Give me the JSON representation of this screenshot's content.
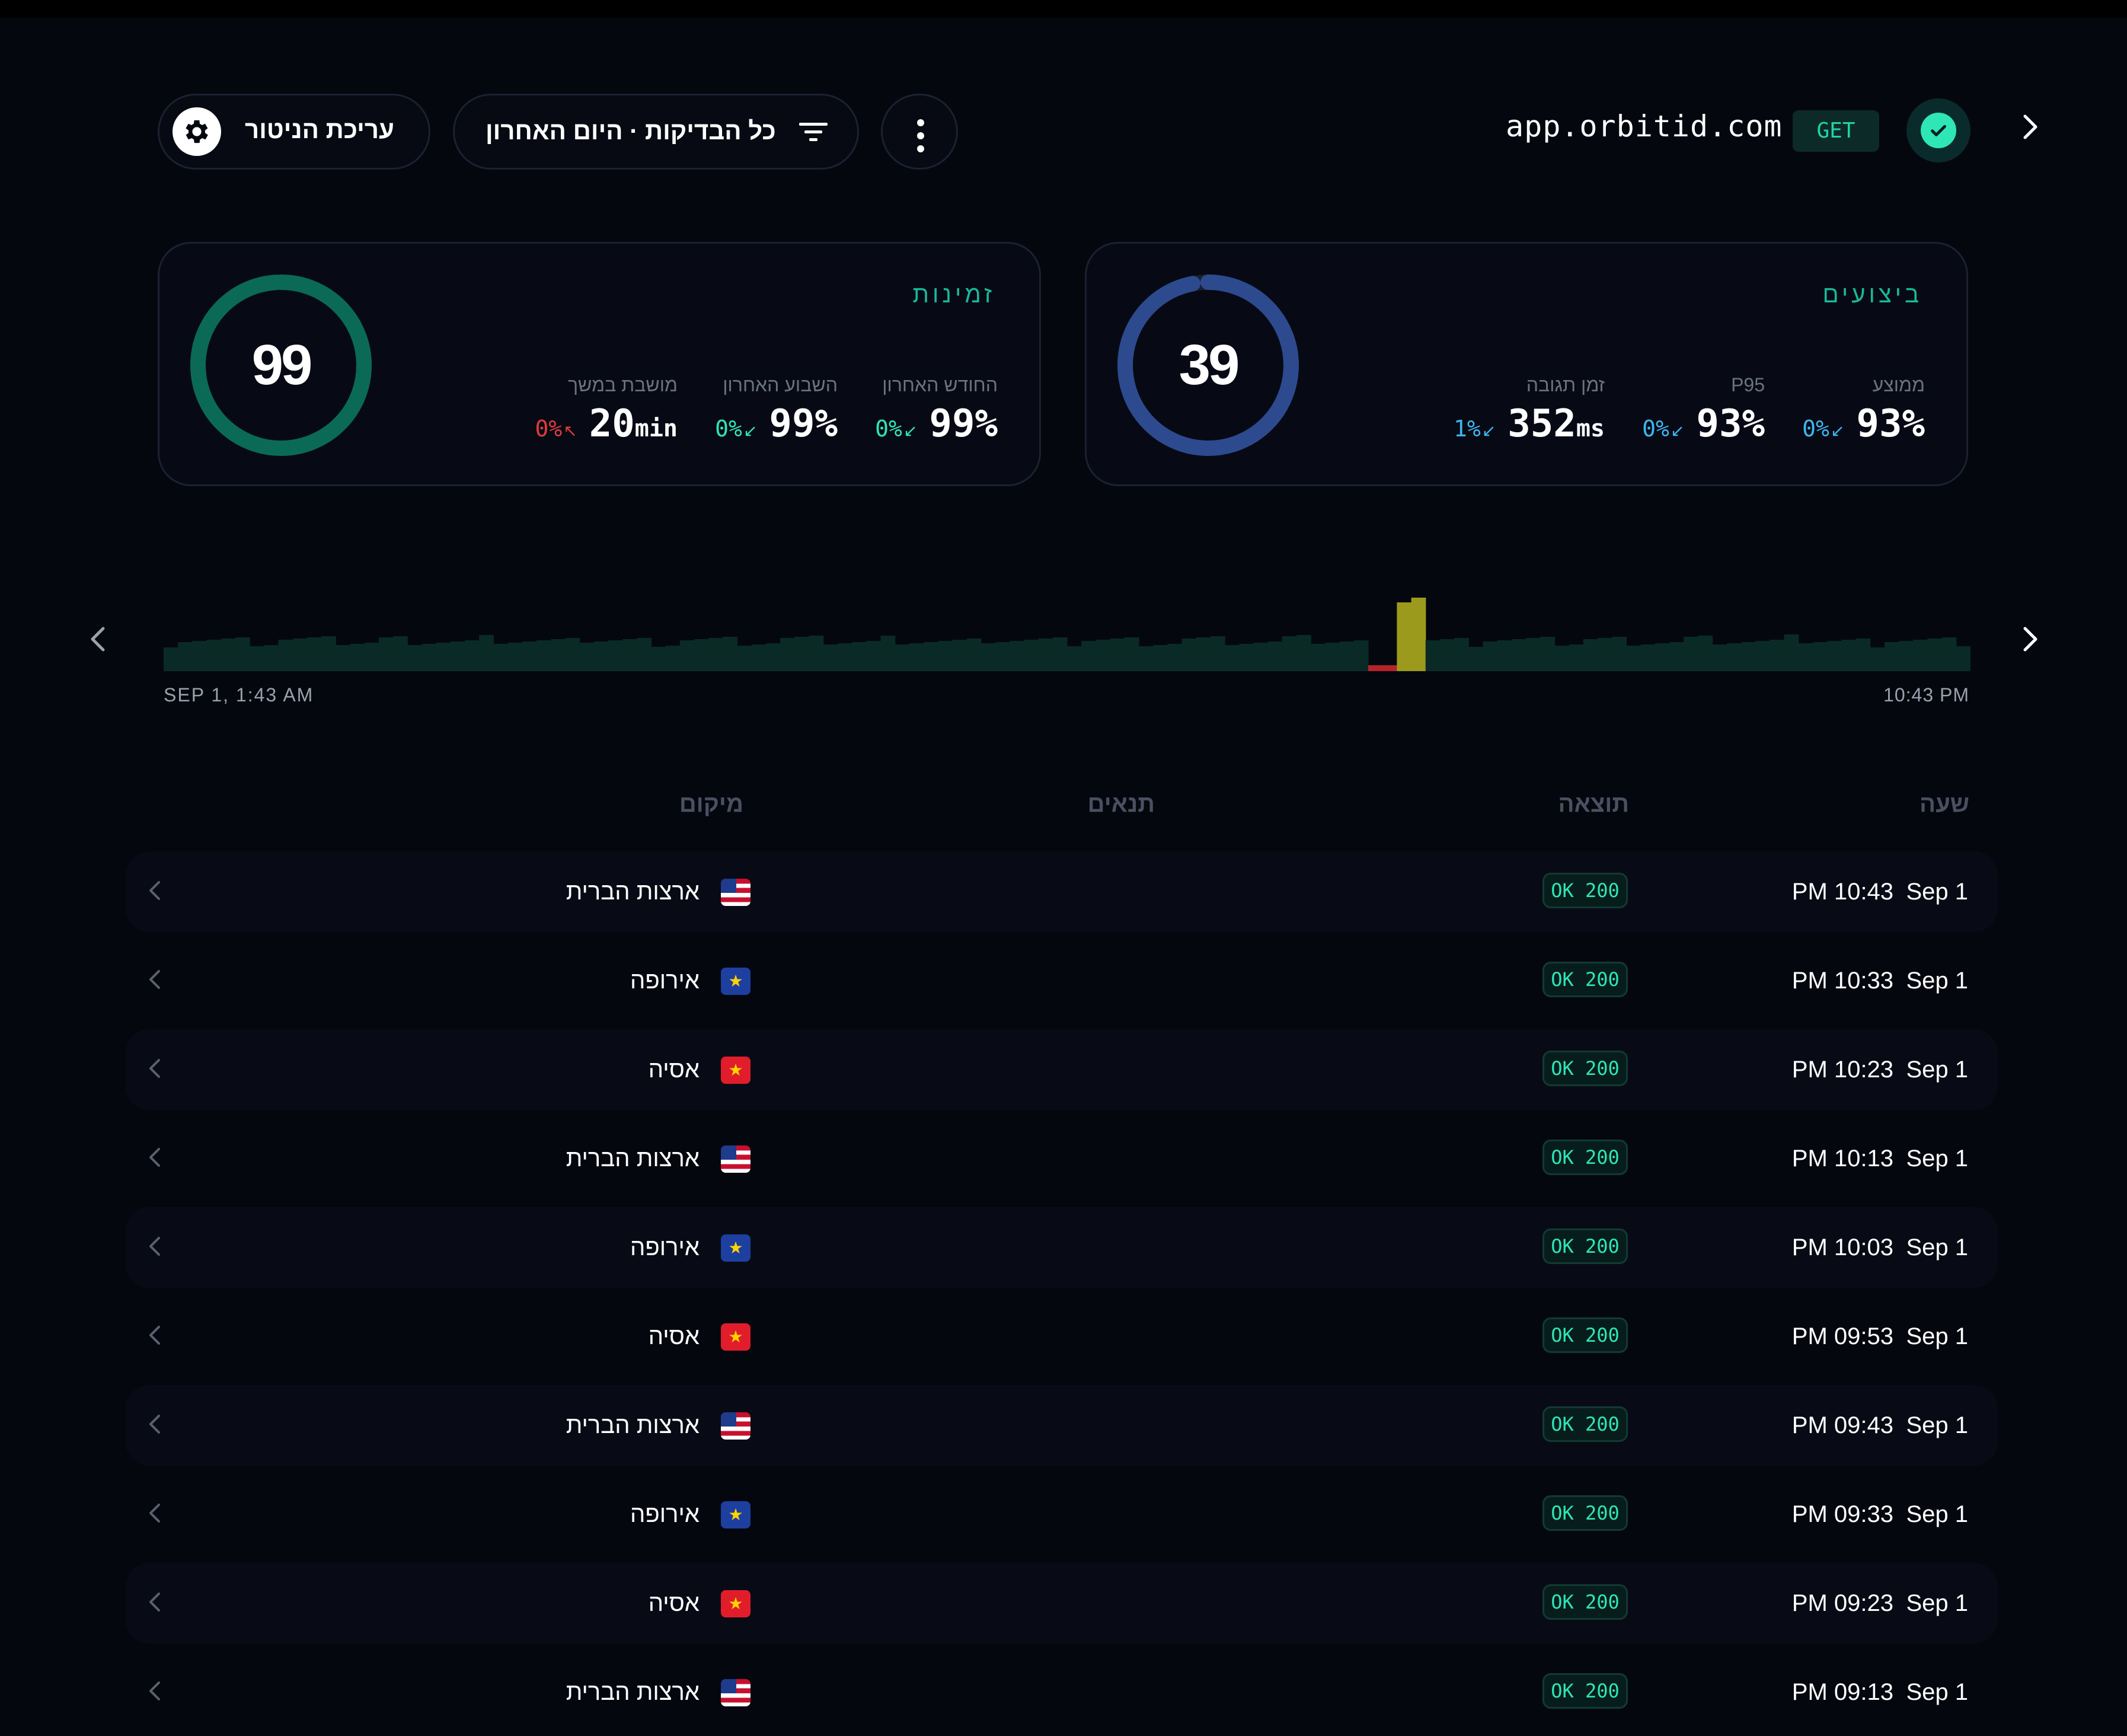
{
  "header": {
    "edit_label": "עריכת הניטור",
    "filter_label": "כל הבדיקות · היום האחרון",
    "domain": "app.orbitid.com",
    "method": "GET"
  },
  "availability": {
    "title": "זמינות",
    "score": "99",
    "score_fraction": 0.99,
    "ring_color": "#0b6a55",
    "metrics": [
      {
        "label": "החודש האחרון",
        "delta": "0%",
        "arrow": "↙",
        "value": "99%",
        "unit": "",
        "delta_color": "#2ee6b6"
      },
      {
        "label": "השבוע האחרון",
        "delta": "0%",
        "arrow": "↙",
        "value": "99%",
        "unit": "",
        "delta_color": "#2ee6b6"
      },
      {
        "label": "מושבת במשך",
        "delta": "0%",
        "arrow": "↖",
        "value": "20",
        "unit": "min",
        "delta_color": "#e03a3a"
      }
    ]
  },
  "performance": {
    "title": "ביצועים",
    "score": "39",
    "score_fraction": 0.97,
    "ring_color": "#2d4a8f",
    "metrics": [
      {
        "label": "ממוצע",
        "delta": "0%",
        "arrow": "↙",
        "value": "93%",
        "unit": "",
        "delta_color": "#3fb6f0"
      },
      {
        "label": "P95",
        "delta": "0%",
        "arrow": "↙",
        "value": "93%",
        "unit": "",
        "delta_color": "#3fb6f0"
      },
      {
        "label": "זמן תגובה",
        "delta": "1%",
        "arrow": "↙",
        "value": "352",
        "unit": "ms",
        "delta_color": "#3fb6f0"
      }
    ]
  },
  "timeline": {
    "start_label": "SEP 1, 1:43 AM",
    "end_label": "10:43 PM",
    "colors": {
      "normal": "#0a2a26",
      "warn": "#9c9a1c",
      "down": "#b3242a"
    }
  },
  "table": {
    "headers": {
      "time": "שעה",
      "result": "תוצאה",
      "conditions": "תנאים",
      "location": "מיקום"
    },
    "rows": [
      {
        "date": "Sep 1",
        "time": "PM 10:43",
        "status": "OK 200",
        "flag": "us",
        "location": "ארצות הברית"
      },
      {
        "date": "Sep 1",
        "time": "PM 10:33",
        "status": "OK 200",
        "flag": "eu",
        "location": "אירופה"
      },
      {
        "date": "Sep 1",
        "time": "PM 10:23",
        "status": "OK 200",
        "flag": "as",
        "location": "אסיה"
      },
      {
        "date": "Sep 1",
        "time": "PM 10:13",
        "status": "OK 200",
        "flag": "us",
        "location": "ארצות הברית"
      },
      {
        "date": "Sep 1",
        "time": "PM 10:03",
        "status": "OK 200",
        "flag": "eu",
        "location": "אירופה"
      },
      {
        "date": "Sep 1",
        "time": "PM 09:53",
        "status": "OK 200",
        "flag": "as",
        "location": "אסיה"
      },
      {
        "date": "Sep 1",
        "time": "PM 09:43",
        "status": "OK 200",
        "flag": "us",
        "location": "ארצות הברית"
      },
      {
        "date": "Sep 1",
        "time": "PM 09:33",
        "status": "OK 200",
        "flag": "eu",
        "location": "אירופה"
      },
      {
        "date": "Sep 1",
        "time": "PM 09:23",
        "status": "OK 200",
        "flag": "as",
        "location": "אסיה"
      },
      {
        "date": "Sep 1",
        "time": "PM 09:13",
        "status": "OK 200",
        "flag": "us",
        "location": "ארצות הברית"
      }
    ]
  }
}
